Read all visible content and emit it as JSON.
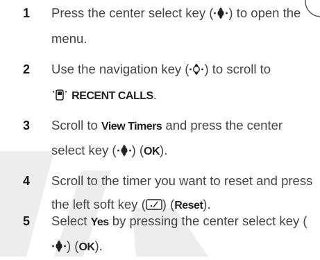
{
  "steps": [
    {
      "number": "1",
      "parts": [
        "Press the center select key (",
        ") to open the menu."
      ],
      "icons": [
        "center-select-key-icon"
      ]
    },
    {
      "number": "2",
      "parts": [
        "Use the navigation key (",
        ") to scroll to"
      ],
      "menu_label": "RECENT CALLS",
      "icons": [
        "navigation-key-icon",
        "recent-calls-icon"
      ]
    },
    {
      "number": "3",
      "parts": [
        "Scroll to ",
        " and press the center select key (",
        ") (",
        ")."
      ],
      "strong": [
        "View Timers",
        "OK"
      ],
      "icons": [
        "center-select-key-icon"
      ]
    },
    {
      "number": "4",
      "parts": [
        "Scroll to the timer you want to reset and press the left soft key (",
        ") (",
        ")."
      ],
      "strong": [
        "Reset"
      ],
      "icons": [
        "left-soft-key-icon"
      ]
    },
    {
      "number": "5",
      "parts": [
        "Select ",
        " by pressing the center select key (",
        ") (",
        ")."
      ],
      "strong": [
        "Yes",
        "OK"
      ],
      "icons": [
        "center-select-key-icon"
      ]
    }
  ],
  "colors": {
    "text": "#444444",
    "watermark": "#ececec"
  }
}
